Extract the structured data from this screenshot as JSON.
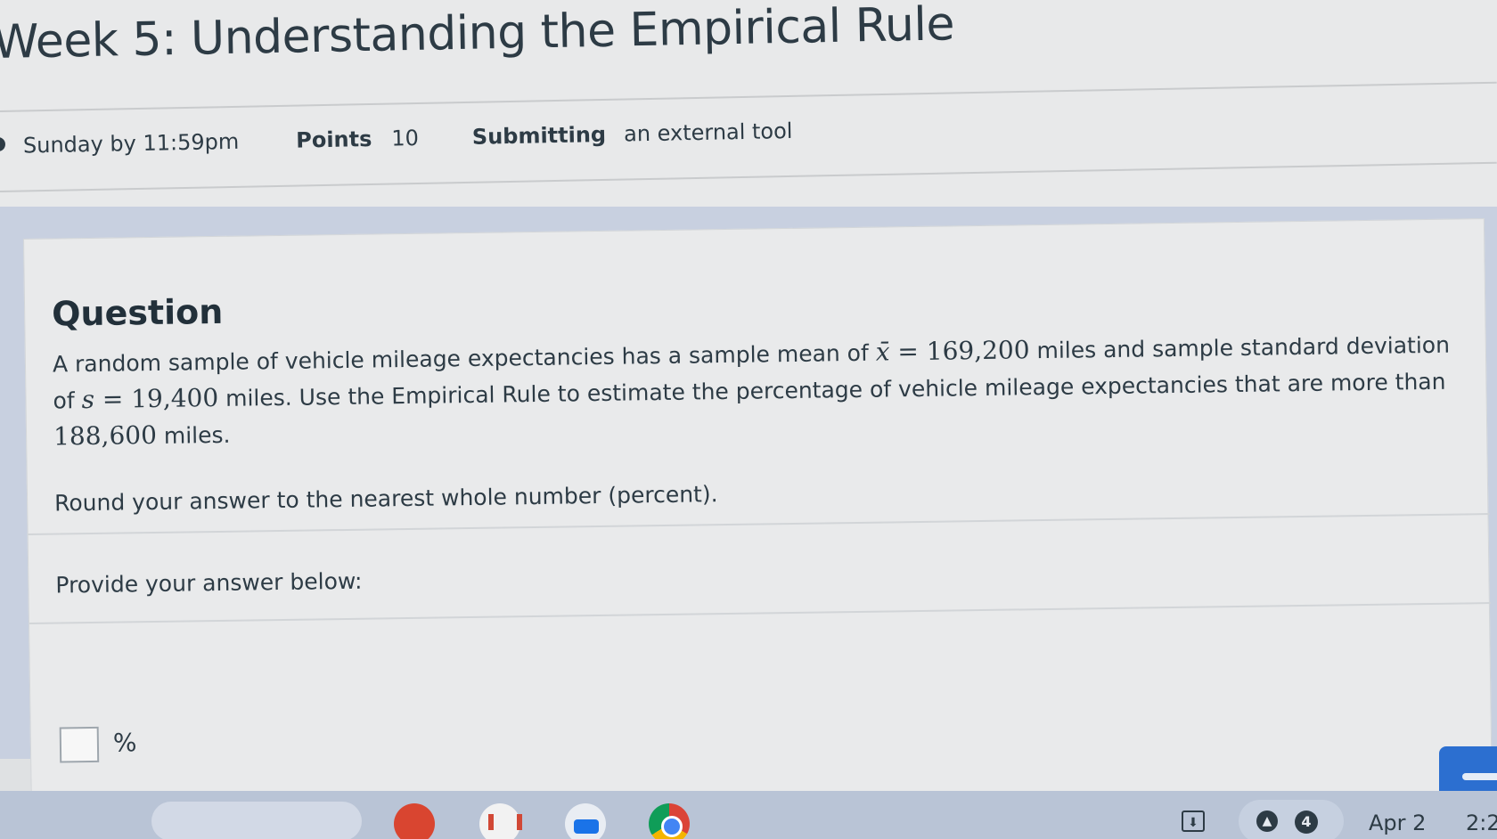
{
  "header": {
    "title": "Week 5: Understanding the Empirical Rule",
    "due": "Sunday by 11:59pm",
    "points_label": "Points",
    "points_value": "10",
    "submitting_label": "Submitting",
    "submitting_value": "an external tool"
  },
  "question": {
    "heading": "Question",
    "text_1": "A random sample of vehicle mileage expectancies has a sample mean of ",
    "mean_symbol": "x̄",
    "equals": " = ",
    "mean_value": "169,200",
    "text_2": " miles and sample standard deviation of ",
    "sd_symbol": "s",
    "sd_value": "19,400",
    "text_3": " miles.  Use the Empirical Rule to estimate the percentage of vehicle mileage expectancies that are more than ",
    "threshold_value": "188,600",
    "text_4": " miles.",
    "instruction": "Round your answer to the nearest whole number (percent).",
    "provide_label": "Provide your answer below:",
    "answer_value": "",
    "answer_unit": "%"
  },
  "taskbar": {
    "notification_count": "4",
    "date": "Apr 2",
    "time": "2:2"
  },
  "colors": {
    "accent_button": "#2c6fd0",
    "taskbar": "#b9c4d6",
    "text": "#2d3b45"
  }
}
